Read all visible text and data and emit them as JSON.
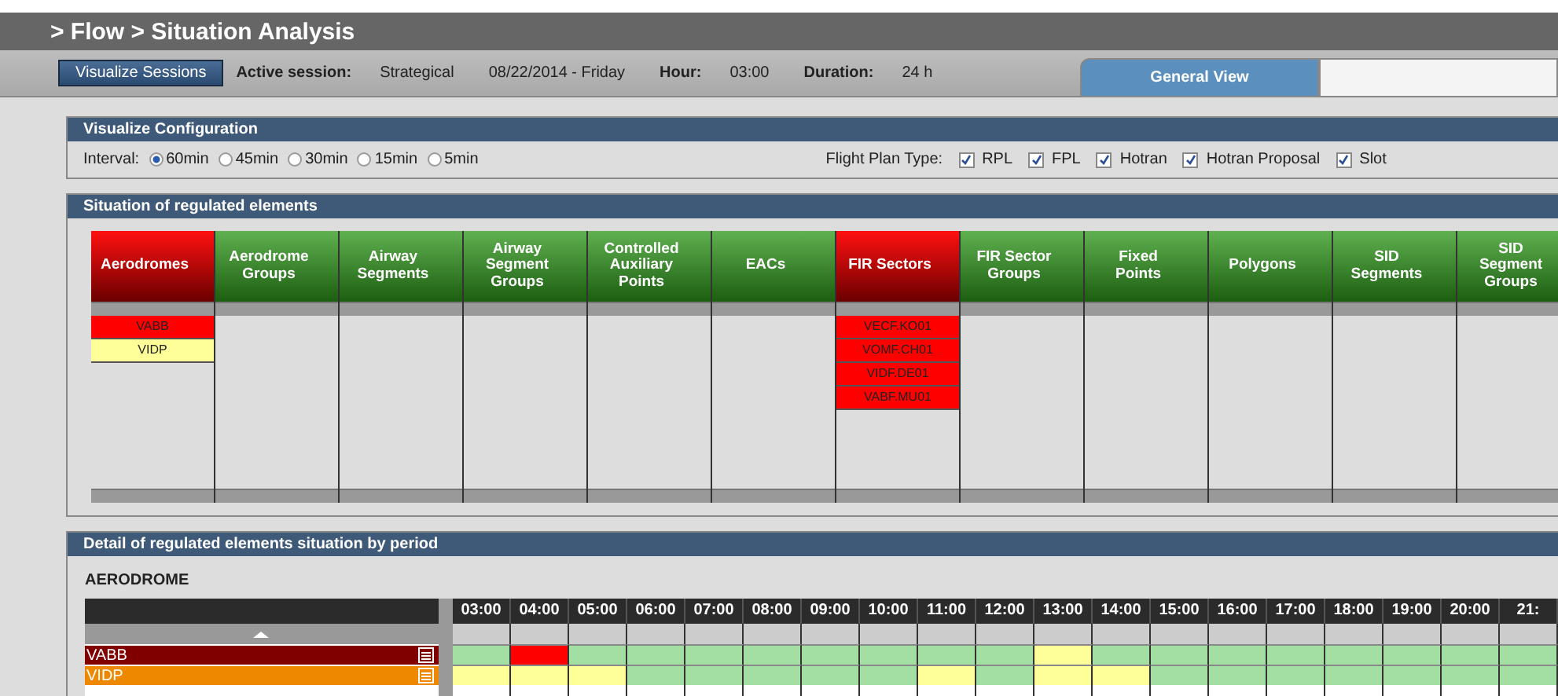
{
  "title": "> Flow > Situation Analysis",
  "toolbar": {
    "button": "Visualize Sessions",
    "fields": [
      {
        "label": "Active session:",
        "value": "Strategical"
      },
      {
        "value": "08/22/2014 - Friday"
      },
      {
        "label": "Hour:",
        "value": "03:00"
      },
      {
        "label": "Duration:",
        "value": "24 h"
      }
    ]
  },
  "view_tabs": [
    {
      "label": "General View",
      "selected": true
    },
    {
      "selected": false
    }
  ],
  "config": {
    "title": "Visualize Configuration",
    "interval_label": "Interval:",
    "intervals": [
      {
        "label": "60min",
        "selected": true
      },
      {
        "label": "45min",
        "selected": false
      },
      {
        "label": "30min",
        "selected": false
      },
      {
        "label": "15min",
        "selected": false
      },
      {
        "label": "5min",
        "selected": false
      }
    ],
    "flight_plan_label": "Flight Plan Type:",
    "flight_plan_types": [
      {
        "label": "RPL",
        "checked": true
      },
      {
        "label": "FPL",
        "checked": true
      },
      {
        "label": "Hotran",
        "checked": true
      },
      {
        "label": "Hotran Proposal",
        "checked": true
      },
      {
        "label": "Slot",
        "checked": true
      }
    ]
  },
  "situation": {
    "title": "Situation of regulated elements",
    "columns": [
      {
        "label": "Aerodromes",
        "alert": true,
        "items": [
          {
            "label": "VABB",
            "color": "#ff0000"
          },
          {
            "label": "VIDP",
            "color": "#ffff99"
          }
        ]
      },
      {
        "label": "Aerodrome Groups",
        "alert": false
      },
      {
        "label": "Airway Segments",
        "alert": false
      },
      {
        "label": "Airway Segment Groups",
        "alert": false
      },
      {
        "label": "Controlled Auxiliary Points",
        "alert": false
      },
      {
        "label": "EACs",
        "alert": false
      },
      {
        "label": "FIR Sectors",
        "alert": true,
        "items": [
          {
            "label": "VECF.KO01",
            "color": "#ff0000"
          },
          {
            "label": "VOMF.CH01",
            "color": "#ff0000"
          },
          {
            "label": "VIDF.DE01",
            "color": "#ff0000"
          },
          {
            "label": "VABF.MU01",
            "color": "#ff0000"
          }
        ]
      },
      {
        "label": "FIR Sector Groups",
        "alert": false
      },
      {
        "label": "Fixed Points",
        "alert": false
      },
      {
        "label": "Polygons",
        "alert": false
      },
      {
        "label": "SID Segments",
        "alert": false
      },
      {
        "label": "SID Segment Groups",
        "alert": false
      }
    ]
  },
  "detail": {
    "title": "Detail of regulated elements situation by period",
    "section": "AERODROME",
    "hours": [
      "03:00",
      "04:00",
      "05:00",
      "06:00",
      "07:00",
      "08:00",
      "09:00",
      "10:00",
      "11:00",
      "12:00",
      "13:00",
      "14:00",
      "15:00",
      "16:00",
      "17:00",
      "18:00",
      "19:00",
      "20:00",
      "21:"
    ],
    "rows": [
      {
        "label": "VABB",
        "color": "#800000",
        "cells": [
          {
            "color": "#a3dfa3"
          },
          {
            "color": "#ff0000"
          },
          {
            "color": "#a3dfa3"
          },
          {
            "color": "#a3dfa3"
          },
          {
            "color": "#a3dfa3"
          },
          {
            "color": "#a3dfa3"
          },
          {
            "color": "#a3dfa3"
          },
          {
            "color": "#a3dfa3"
          },
          {
            "color": "#a3dfa3"
          },
          {
            "color": "#a3dfa3"
          },
          {
            "color": "#ffff99"
          },
          {
            "color": "#a3dfa3"
          },
          {
            "color": "#a3dfa3"
          },
          {
            "color": "#a3dfa3"
          },
          {
            "color": "#a3dfa3"
          },
          {
            "color": "#a3dfa3"
          },
          {
            "color": "#a3dfa3"
          },
          {
            "color": "#a3dfa3"
          },
          {
            "color": "#a3dfa3"
          }
        ]
      },
      {
        "label": "VIDP",
        "color": "#ee8800",
        "cells": [
          {
            "color": "#ffff99"
          },
          {
            "color": "#ffff99"
          },
          {
            "color": "#ffff99"
          },
          {
            "color": "#a3dfa3"
          },
          {
            "color": "#a3dfa3"
          },
          {
            "color": "#a3dfa3"
          },
          {
            "color": "#a3dfa3"
          },
          {
            "color": "#a3dfa3"
          },
          {
            "color": "#ffff99"
          },
          {
            "color": "#a3dfa3"
          },
          {
            "color": "#ffff99"
          },
          {
            "color": "#ffff99"
          },
          {
            "color": "#a3dfa3"
          },
          {
            "color": "#a3dfa3"
          },
          {
            "color": "#a3dfa3"
          },
          {
            "color": "#a3dfa3"
          },
          {
            "color": "#a3dfa3"
          },
          {
            "color": "#a3dfa3"
          },
          {
            "color": "#a3dfa3"
          }
        ]
      }
    ]
  }
}
